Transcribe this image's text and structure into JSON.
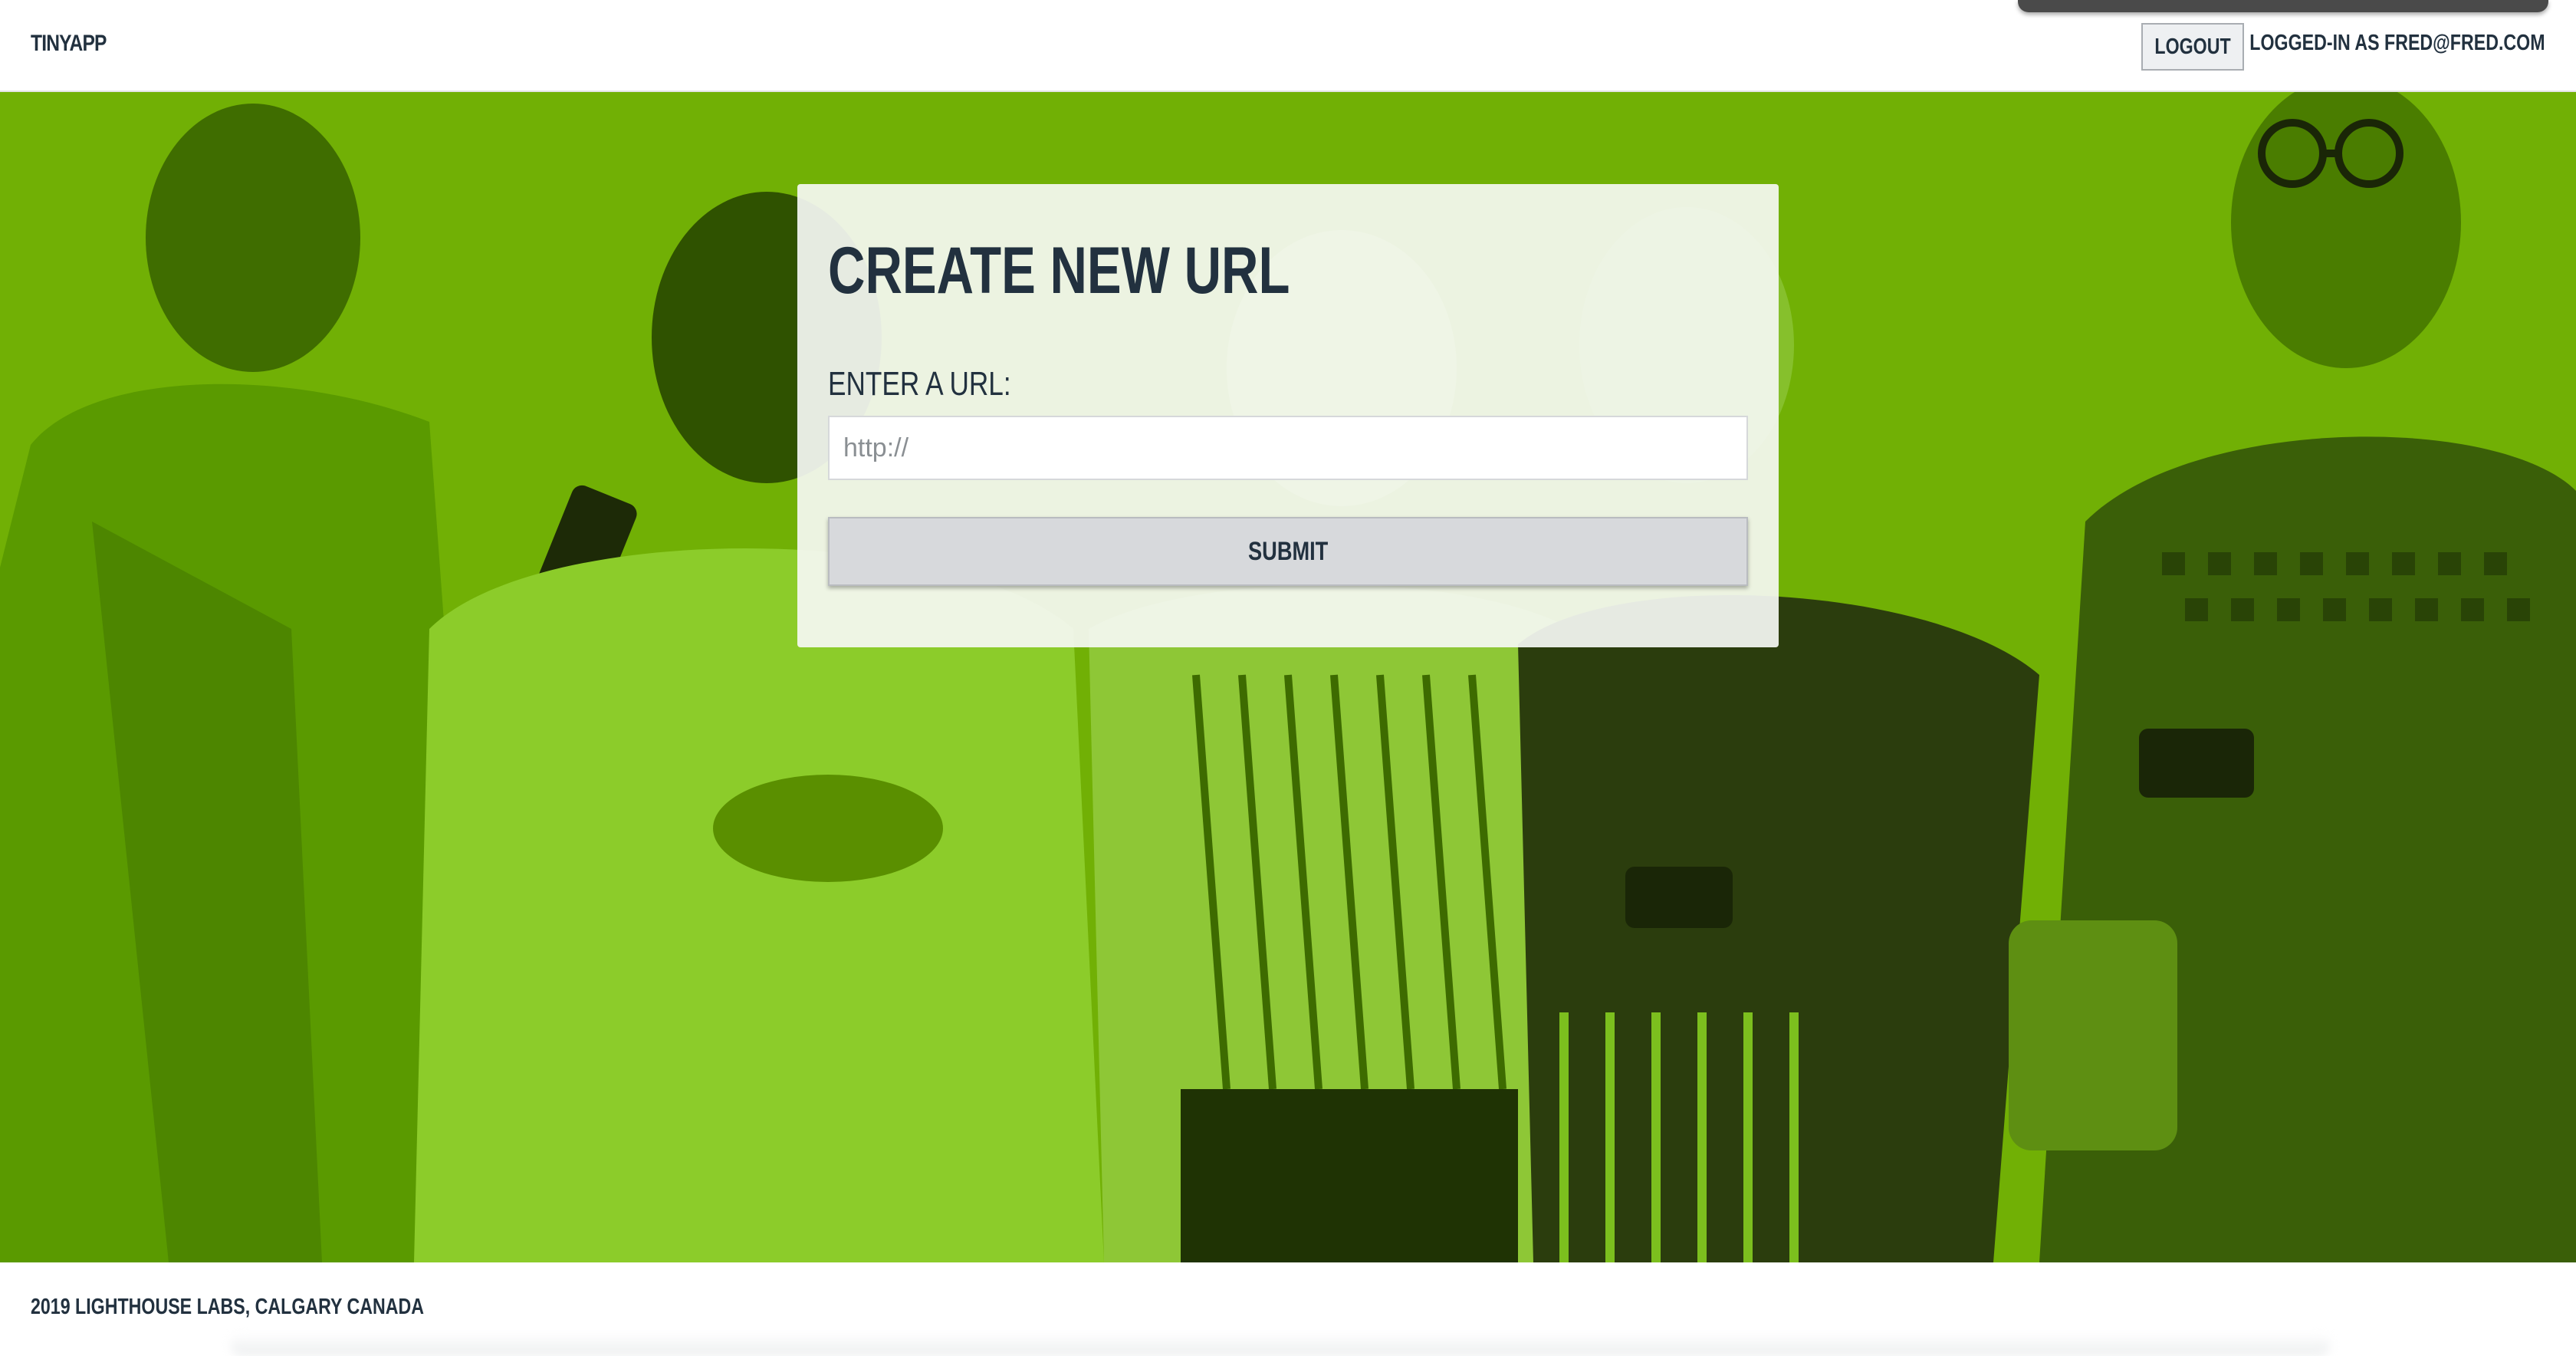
{
  "nav": {
    "brand": "TINYAPP",
    "logout_label": "LOGOUT",
    "user_label": "LOGGED-IN AS FRED@FRED.COM"
  },
  "hero": {
    "background_color": "#6cab00",
    "image_description_icon": "people-using-phones-photo"
  },
  "form": {
    "title": "CREATE NEW URL",
    "url_label": "ENTER A URL:",
    "url_placeholder": "http://",
    "url_value": "",
    "submit_label": "SUBMIT"
  },
  "footer": {
    "text": "2019 LIGHTHOUSE LABS, CALGARY CANADA"
  },
  "colors": {
    "accent_green": "#6cab00",
    "text_dark": "#22313f",
    "button_gray": "#d7d9dc"
  }
}
